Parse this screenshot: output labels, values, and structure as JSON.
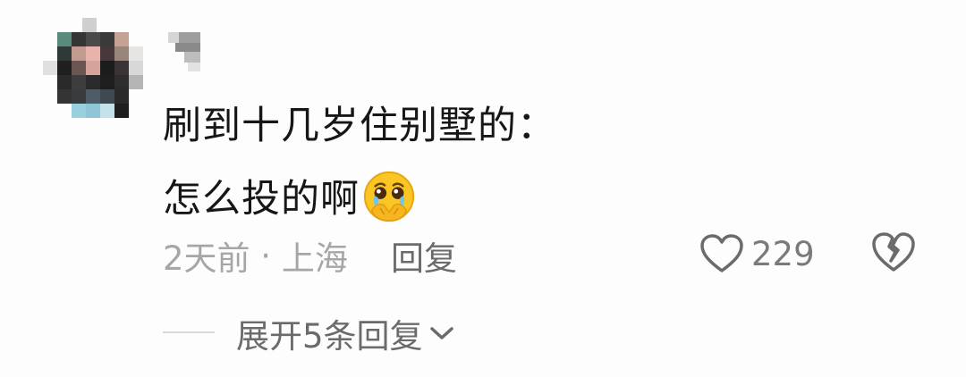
{
  "comment": {
    "author": {
      "name_hidden": true
    },
    "text_line1": "刷到十几岁住别墅的：",
    "text_line2": "怎么投的啊",
    "emoji": "pleading-face-holding-back-tears",
    "time": "2天前",
    "separator": " · ",
    "location": "上海",
    "reply_label": "回复",
    "like_count": "229"
  },
  "replies": {
    "expand_label": "展开5条回复"
  },
  "colors": {
    "text": "#161616",
    "meta": "#a6a6a6",
    "action": "#6b6b6b",
    "emoji": "#f7c21a"
  }
}
